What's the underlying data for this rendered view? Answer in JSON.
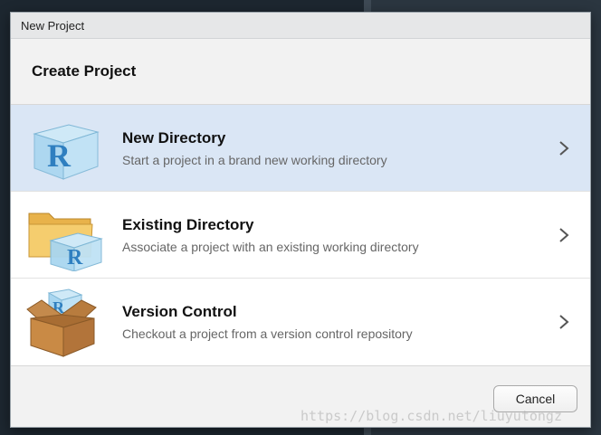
{
  "dialog": {
    "title": "New Project",
    "heading": "Create Project",
    "options": [
      {
        "title": "New Directory",
        "description": "Start a project in a brand new working directory",
        "icon": "r-cube-icon",
        "selected": true
      },
      {
        "title": "Existing Directory",
        "description": "Associate a project with an existing working directory",
        "icon": "folder-r-icon",
        "selected": false
      },
      {
        "title": "Version Control",
        "description": "Checkout a project from a version control repository",
        "icon": "box-r-icon",
        "selected": false
      }
    ],
    "cancel_label": "Cancel"
  },
  "watermark": "https://blog.csdn.net/liuyutongz"
}
